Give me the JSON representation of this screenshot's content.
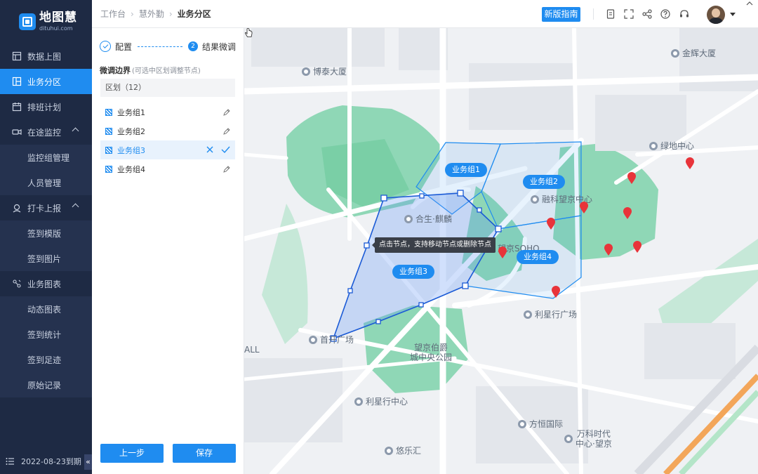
{
  "app": {
    "name": "地图慧",
    "domain": "dituhui.com"
  },
  "sidebar": {
    "items": [
      {
        "label": "数据上图",
        "icon": "grid-icon"
      },
      {
        "label": "业务分区",
        "icon": "layout-icon",
        "active": true
      },
      {
        "label": "排班计划",
        "icon": "calendar-icon"
      },
      {
        "label": "在途监控",
        "icon": "camera-icon",
        "expanded": true
      },
      {
        "label": "打卡上报",
        "icon": "location-icon",
        "expanded": true
      },
      {
        "label": "业务图表",
        "icon": "chart-icon"
      }
    ],
    "monitor_sub": [
      "监控组管理",
      "人员管理"
    ],
    "report_sub": [
      "签到模版",
      "签到图片"
    ],
    "chart_sub": [
      "动态图表",
      "签到统计",
      "签到足迹",
      "原始记录"
    ],
    "expiry": "2022-08-23到期",
    "collapse_glyph": "«"
  },
  "header": {
    "breadcrumb": [
      "工作台",
      "慧外勤",
      "业务分区"
    ],
    "guide_button": "新版指南",
    "icons": [
      "document-icon",
      "fullscreen-icon",
      "share-icon",
      "help-icon",
      "headset-icon"
    ]
  },
  "panel": {
    "steps": [
      {
        "label": "配置",
        "status": "done"
      },
      {
        "number": "2",
        "label": "结果微调",
        "status": "active"
      }
    ],
    "section_title": "微调边界",
    "section_hint": "(可选中区划调整节点)",
    "region_header": "区划（12）",
    "groups": [
      {
        "label": "业务组1",
        "selected": false
      },
      {
        "label": "业务组2",
        "selected": false
      },
      {
        "label": "业务组3",
        "selected": true
      },
      {
        "label": "业务组4",
        "selected": false
      }
    ],
    "prev_button": "上一步",
    "save_button": "保存"
  },
  "map": {
    "pois": [
      "金辉大厦",
      "博泰大厦",
      "绿地中心",
      "融科望京中心",
      "合生·麒麟",
      "望京SOHO",
      "利星行广场",
      "首开广场",
      "望京伯爵",
      "城中央公园",
      "利星行中心",
      "方恒国际",
      "万科时代",
      "中心·望京",
      "悠乐汇",
      "ALL"
    ],
    "zones": [
      "业务组1",
      "业务组2",
      "业务组3",
      "业务组4"
    ],
    "tooltip": "点击节点，支持移动节点或删除节点",
    "colors": {
      "accent": "#1f8cf0",
      "park": "#8fd7b6",
      "pin": "#e8343a"
    }
  }
}
